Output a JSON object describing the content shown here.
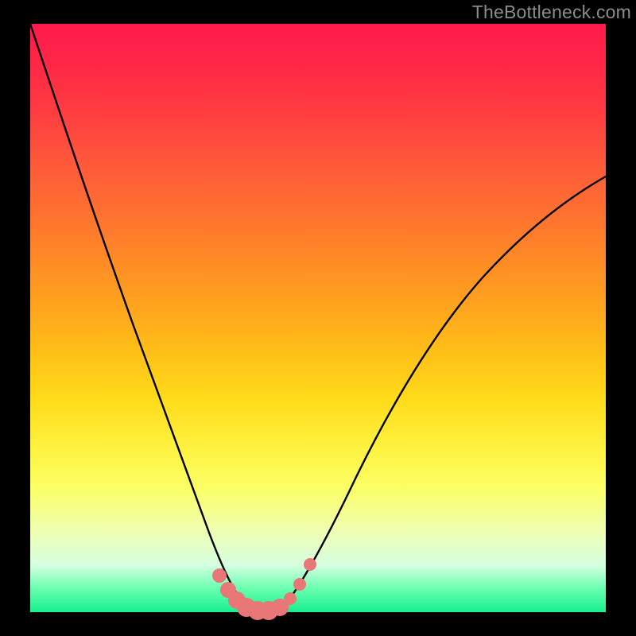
{
  "watermark": "TheBottleneck.com",
  "chart_data": {
    "type": "line",
    "title": "",
    "xlabel": "",
    "ylabel": "",
    "xlim": [
      0,
      1
    ],
    "ylim": [
      0,
      1
    ],
    "background_gradient": {
      "top_color": "#ff1a4d",
      "mid_color": "#ffd020",
      "bottom_color": "#17f08d"
    },
    "series": [
      {
        "name": "bottleneck-curve",
        "x": [
          0.0,
          0.045,
          0.09,
          0.135,
          0.18,
          0.225,
          0.26,
          0.29,
          0.31,
          0.33,
          0.35,
          0.37,
          0.39,
          0.41,
          0.43,
          0.46,
          0.5,
          0.56,
          0.63,
          0.71,
          0.8,
          0.9,
          1.0
        ],
        "y": [
          1.0,
          0.81,
          0.64,
          0.48,
          0.34,
          0.22,
          0.14,
          0.08,
          0.045,
          0.022,
          0.01,
          0.004,
          0.004,
          0.01,
          0.025,
          0.06,
          0.13,
          0.24,
          0.36,
          0.48,
          0.59,
          0.68,
          0.75
        ]
      }
    ],
    "markers": {
      "name": "highlighted-points",
      "color": "#e97777",
      "x": [
        0.305,
        0.322,
        0.34,
        0.358,
        0.378,
        0.398,
        0.418,
        0.438,
        0.458,
        0.48
      ],
      "y": [
        0.058,
        0.036,
        0.018,
        0.007,
        0.003,
        0.003,
        0.009,
        0.022,
        0.045,
        0.085
      ]
    }
  }
}
